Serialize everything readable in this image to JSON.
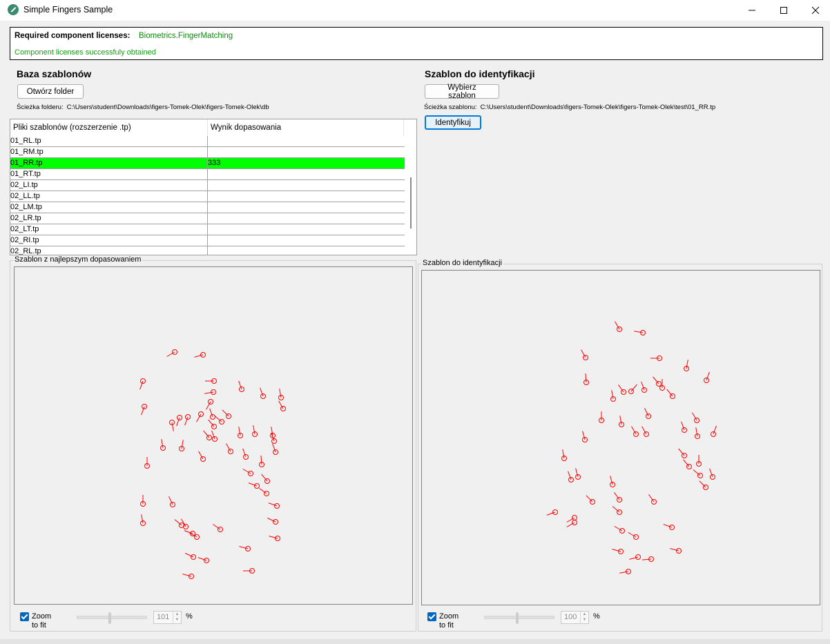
{
  "window": {
    "title": "Simple Fingers Sample"
  },
  "licenses": {
    "label": "Required component licenses:",
    "value": "Biometrics.FingerMatching",
    "status": "Component licenses successfuly obtained"
  },
  "db": {
    "title": "Baza szablonów",
    "open_button": "Otwórz folder",
    "path_label": "Ścieżka folderu:",
    "path_value": "C:\\Users\\student\\Downloads\\figers-Tomek-Olek\\figers-Tomek-Olek\\db",
    "columns": [
      "Pliki szablonów (rozszerzenie .tp)",
      "Wynik dopasowania"
    ],
    "rows": [
      {
        "file": "01_RL.tp",
        "score": ""
      },
      {
        "file": "01_RM.tp",
        "score": ""
      },
      {
        "file": "01_RR.tp",
        "score": "333"
      },
      {
        "file": "01_RT.tp",
        "score": ""
      },
      {
        "file": "02_LI.tp",
        "score": ""
      },
      {
        "file": "02_LL.tp",
        "score": ""
      },
      {
        "file": "02_LM.tp",
        "score": ""
      },
      {
        "file": "02_LR.tp",
        "score": ""
      },
      {
        "file": "02_LT.tp",
        "score": ""
      },
      {
        "file": "02_RI.tp",
        "score": ""
      },
      {
        "file": "02_RL.tp",
        "score": ""
      }
    ],
    "selected_index": 2
  },
  "ident": {
    "title": "Szablon do identyfikacji",
    "select_button": "Wybierz szablon",
    "path_label": "Ścieżka szablonu:",
    "path_value": "C:\\Users\\student\\Downloads\\figers-Tomek-Olek\\figers-Tomek-Olek\\test\\01_RR.tp",
    "identify_button": "Identyfikuj"
  },
  "left_view": {
    "title": "Szablon z najlepszym dopasowaniem",
    "zoom_label": "Zoom to fit",
    "zoom_checked": true,
    "zoom_value": "101",
    "unit": "%"
  },
  "right_view": {
    "title": "Szablon do identyfikacji",
    "zoom_label": "Zoom to fit",
    "zoom_checked": true,
    "zoom_value": "100",
    "unit": "%"
  },
  "colors": {
    "minutiae": "#ff0000",
    "selected_row": "#00ff00",
    "license_ok": "#12a012"
  },
  "icons": {
    "app": "fingerprint-app-icon",
    "minimize": "minimize-icon",
    "maximize": "maximize-icon",
    "close": "close-icon"
  }
}
